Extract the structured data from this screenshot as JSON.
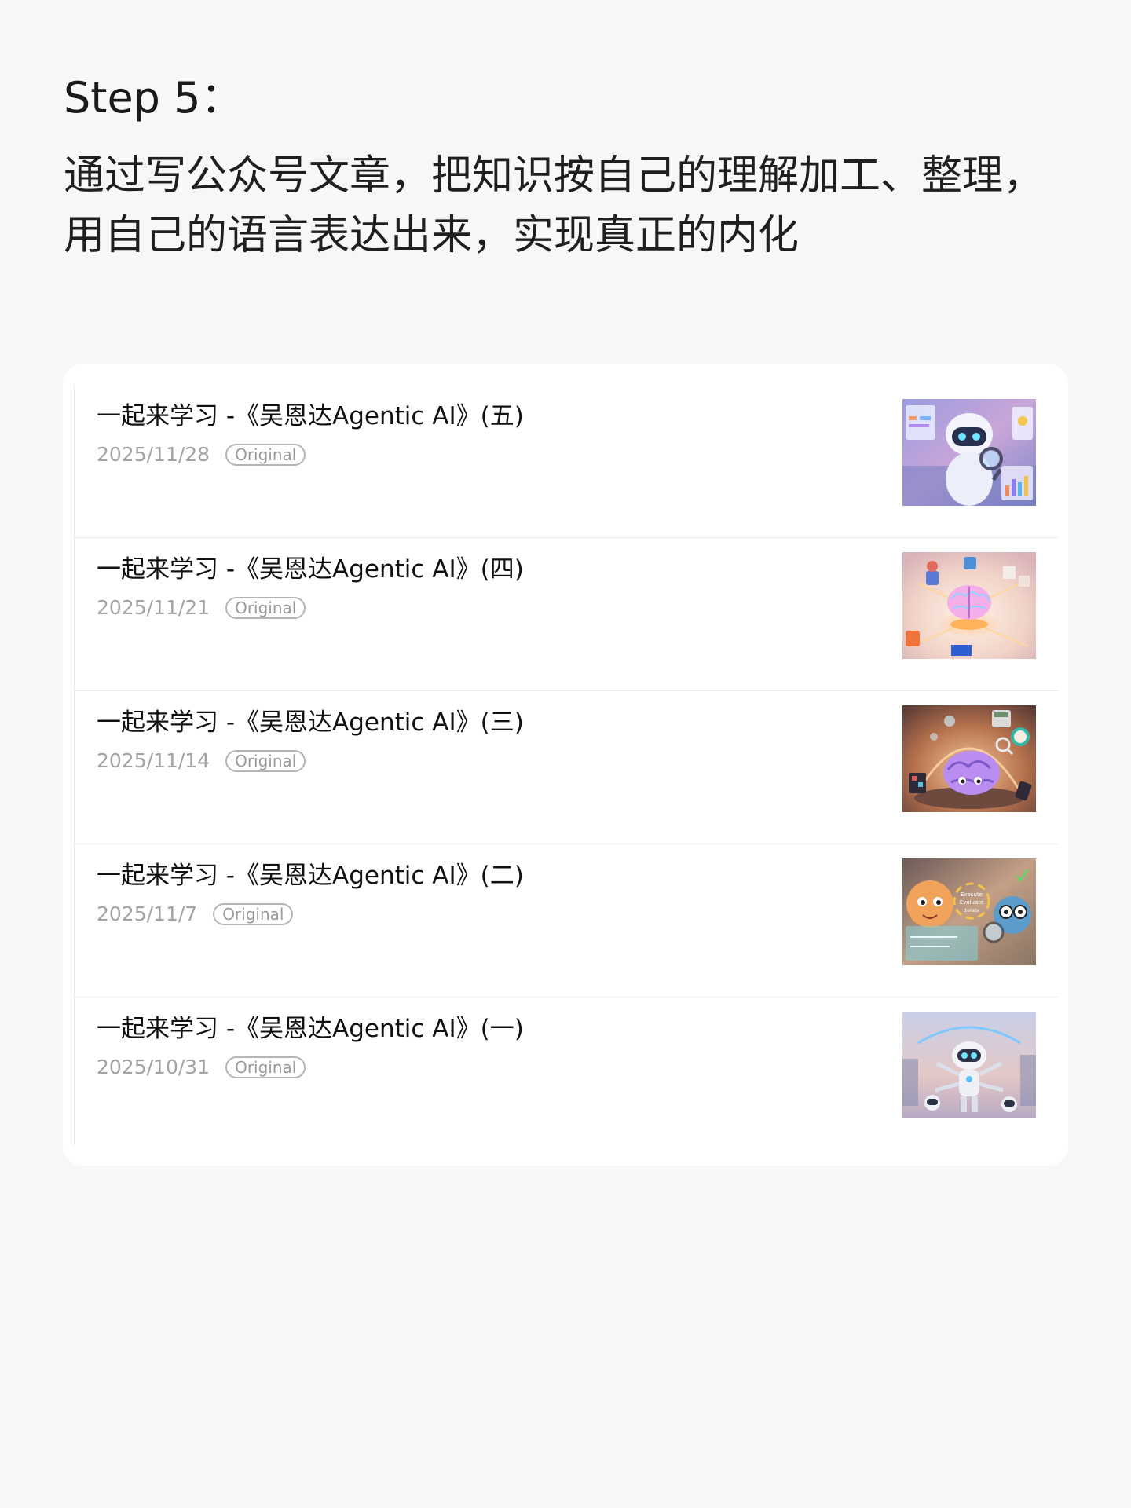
{
  "header": {
    "step_title": "Step 5：",
    "description": "通过写公众号文章，把知识按自己的理解加工、整理，用自己的语言表达出来，实现真正的内化"
  },
  "articles": [
    {
      "title": "一起来学习 -《吴恩达Agentic AI》(五)",
      "date": "2025/11/28",
      "badge": "Original",
      "thumbnail_icon": "robot-with-magnifier-icon"
    },
    {
      "title": "一起来学习 -《吴恩达Agentic AI》(四)",
      "date": "2025/11/21",
      "badge": "Original",
      "thumbnail_icon": "glowing-brain-icon"
    },
    {
      "title": "一起来学习 -《吴恩达Agentic AI》(三)",
      "date": "2025/11/14",
      "badge": "Original",
      "thumbnail_icon": "cartoon-brain-icon"
    },
    {
      "title": "一起来学习 -《吴恩达Agentic AI》(二)",
      "date": "2025/11/7",
      "badge": "Original",
      "thumbnail_icon": "execute-evaluate-iterate-icon"
    },
    {
      "title": "一起来学习 -《吴恩达Agentic AI》(一)",
      "date": "2025/10/31",
      "badge": "Original",
      "thumbnail_icon": "multi-arm-robot-icon"
    }
  ],
  "thumbnail_text": {
    "execute": "Execute",
    "evaluate": "Evaluate",
    "iterate": "Iterate"
  },
  "colors": {
    "background": "#f7f7f7",
    "card": "#ffffff",
    "date": "#a3a3a3",
    "badge_border": "#b5b5b5"
  }
}
